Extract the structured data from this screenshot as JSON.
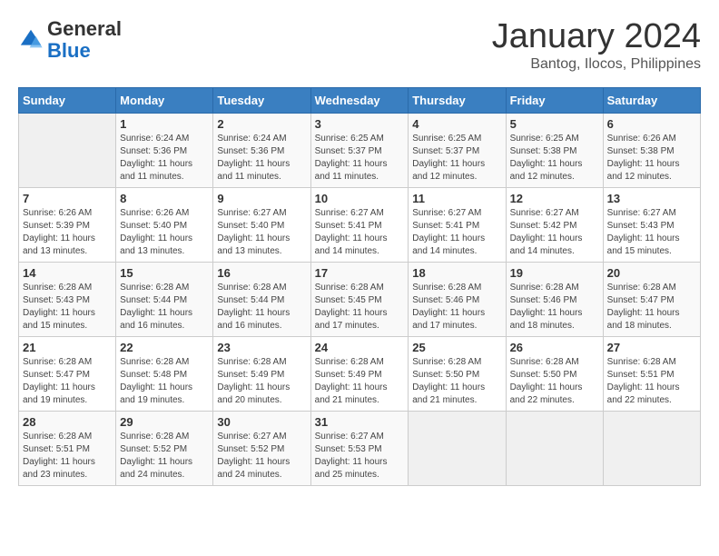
{
  "header": {
    "logo_general": "General",
    "logo_blue": "Blue",
    "month_title": "January 2024",
    "location": "Bantog, Ilocos, Philippines"
  },
  "columns": [
    "Sunday",
    "Monday",
    "Tuesday",
    "Wednesday",
    "Thursday",
    "Friday",
    "Saturday"
  ],
  "weeks": [
    [
      {
        "day": "",
        "sunrise": "",
        "sunset": "",
        "daylight": ""
      },
      {
        "day": "1",
        "sunrise": "6:24 AM",
        "sunset": "5:36 PM",
        "daylight": "11 hours and 11 minutes."
      },
      {
        "day": "2",
        "sunrise": "6:24 AM",
        "sunset": "5:36 PM",
        "daylight": "11 hours and 11 minutes."
      },
      {
        "day": "3",
        "sunrise": "6:25 AM",
        "sunset": "5:37 PM",
        "daylight": "11 hours and 11 minutes."
      },
      {
        "day": "4",
        "sunrise": "6:25 AM",
        "sunset": "5:37 PM",
        "daylight": "11 hours and 12 minutes."
      },
      {
        "day": "5",
        "sunrise": "6:25 AM",
        "sunset": "5:38 PM",
        "daylight": "11 hours and 12 minutes."
      },
      {
        "day": "6",
        "sunrise": "6:26 AM",
        "sunset": "5:38 PM",
        "daylight": "11 hours and 12 minutes."
      }
    ],
    [
      {
        "day": "7",
        "sunrise": "6:26 AM",
        "sunset": "5:39 PM",
        "daylight": "11 hours and 13 minutes."
      },
      {
        "day": "8",
        "sunrise": "6:26 AM",
        "sunset": "5:40 PM",
        "daylight": "11 hours and 13 minutes."
      },
      {
        "day": "9",
        "sunrise": "6:27 AM",
        "sunset": "5:40 PM",
        "daylight": "11 hours and 13 minutes."
      },
      {
        "day": "10",
        "sunrise": "6:27 AM",
        "sunset": "5:41 PM",
        "daylight": "11 hours and 14 minutes."
      },
      {
        "day": "11",
        "sunrise": "6:27 AM",
        "sunset": "5:41 PM",
        "daylight": "11 hours and 14 minutes."
      },
      {
        "day": "12",
        "sunrise": "6:27 AM",
        "sunset": "5:42 PM",
        "daylight": "11 hours and 14 minutes."
      },
      {
        "day": "13",
        "sunrise": "6:27 AM",
        "sunset": "5:43 PM",
        "daylight": "11 hours and 15 minutes."
      }
    ],
    [
      {
        "day": "14",
        "sunrise": "6:28 AM",
        "sunset": "5:43 PM",
        "daylight": "11 hours and 15 minutes."
      },
      {
        "day": "15",
        "sunrise": "6:28 AM",
        "sunset": "5:44 PM",
        "daylight": "11 hours and 16 minutes."
      },
      {
        "day": "16",
        "sunrise": "6:28 AM",
        "sunset": "5:44 PM",
        "daylight": "11 hours and 16 minutes."
      },
      {
        "day": "17",
        "sunrise": "6:28 AM",
        "sunset": "5:45 PM",
        "daylight": "11 hours and 17 minutes."
      },
      {
        "day": "18",
        "sunrise": "6:28 AM",
        "sunset": "5:46 PM",
        "daylight": "11 hours and 17 minutes."
      },
      {
        "day": "19",
        "sunrise": "6:28 AM",
        "sunset": "5:46 PM",
        "daylight": "11 hours and 18 minutes."
      },
      {
        "day": "20",
        "sunrise": "6:28 AM",
        "sunset": "5:47 PM",
        "daylight": "11 hours and 18 minutes."
      }
    ],
    [
      {
        "day": "21",
        "sunrise": "6:28 AM",
        "sunset": "5:47 PM",
        "daylight": "11 hours and 19 minutes."
      },
      {
        "day": "22",
        "sunrise": "6:28 AM",
        "sunset": "5:48 PM",
        "daylight": "11 hours and 19 minutes."
      },
      {
        "day": "23",
        "sunrise": "6:28 AM",
        "sunset": "5:49 PM",
        "daylight": "11 hours and 20 minutes."
      },
      {
        "day": "24",
        "sunrise": "6:28 AM",
        "sunset": "5:49 PM",
        "daylight": "11 hours and 21 minutes."
      },
      {
        "day": "25",
        "sunrise": "6:28 AM",
        "sunset": "5:50 PM",
        "daylight": "11 hours and 21 minutes."
      },
      {
        "day": "26",
        "sunrise": "6:28 AM",
        "sunset": "5:50 PM",
        "daylight": "11 hours and 22 minutes."
      },
      {
        "day": "27",
        "sunrise": "6:28 AM",
        "sunset": "5:51 PM",
        "daylight": "11 hours and 22 minutes."
      }
    ],
    [
      {
        "day": "28",
        "sunrise": "6:28 AM",
        "sunset": "5:51 PM",
        "daylight": "11 hours and 23 minutes."
      },
      {
        "day": "29",
        "sunrise": "6:28 AM",
        "sunset": "5:52 PM",
        "daylight": "11 hours and 24 minutes."
      },
      {
        "day": "30",
        "sunrise": "6:27 AM",
        "sunset": "5:52 PM",
        "daylight": "11 hours and 24 minutes."
      },
      {
        "day": "31",
        "sunrise": "6:27 AM",
        "sunset": "5:53 PM",
        "daylight": "11 hours and 25 minutes."
      },
      {
        "day": "",
        "sunrise": "",
        "sunset": "",
        "daylight": ""
      },
      {
        "day": "",
        "sunrise": "",
        "sunset": "",
        "daylight": ""
      },
      {
        "day": "",
        "sunrise": "",
        "sunset": "",
        "daylight": ""
      }
    ]
  ]
}
